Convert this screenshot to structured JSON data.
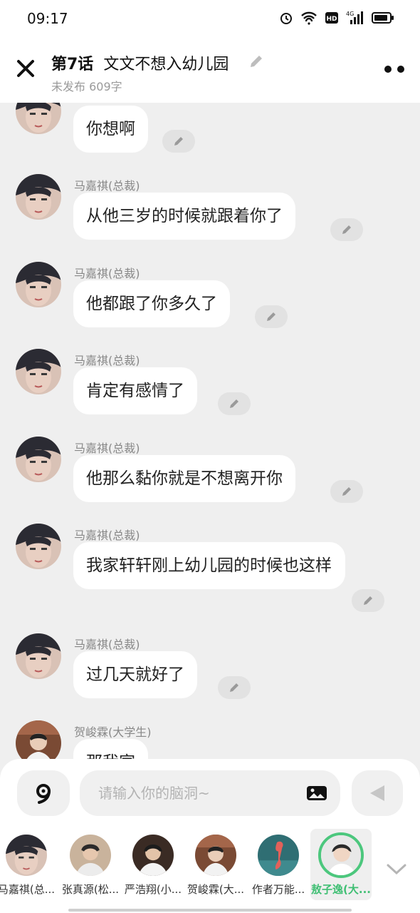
{
  "status_bar": {
    "time": "09:17",
    "network": "4G"
  },
  "header": {
    "episode": "第7话",
    "title": "文文不想入幼儿园",
    "subtitle": "未发布 609字"
  },
  "messages": [
    {
      "name": "",
      "text": "你想啊",
      "avatar": "masked-face"
    },
    {
      "name": "马嘉祺(总裁)",
      "text": "从他三岁的时候就跟着你了",
      "avatar": "masked-face"
    },
    {
      "name": "马嘉祺(总裁)",
      "text": "他都跟了你多久了",
      "avatar": "masked-face"
    },
    {
      "name": "马嘉祺(总裁)",
      "text": "肯定有感情了",
      "avatar": "masked-face"
    },
    {
      "name": "马嘉祺(总裁)",
      "text": "他那么黏你就是不想离开你",
      "avatar": "masked-face"
    },
    {
      "name": "马嘉祺(总裁)",
      "text": "我家轩轩刚上幼儿园的时候也这样",
      "avatar": "masked-face"
    },
    {
      "name": "马嘉祺(总裁)",
      "text": "过几天就好了",
      "avatar": "masked-face"
    },
    {
      "name": "贺峻霖(大学生)",
      "text": "那我家",
      "avatar": "person-photo"
    }
  ],
  "composer": {
    "placeholder": "请输入你的脑洞~"
  },
  "characters": [
    {
      "name": "马嘉祺(总...",
      "avatar": "masked-face"
    },
    {
      "name": "张真源(松...",
      "avatar": "person-photo"
    },
    {
      "name": "严浩翔(小...",
      "avatar": "person-photo"
    },
    {
      "name": "贺峻霖(大...",
      "avatar": "person-photo"
    },
    {
      "name": "作者万能...",
      "avatar": "flamingo"
    },
    {
      "name": "敖子逸(大...",
      "avatar": "person-photo",
      "selected": true
    }
  ],
  "colors": {
    "accent": "#3fbf73",
    "background": "#efefef",
    "bubble": "#ffffff"
  }
}
